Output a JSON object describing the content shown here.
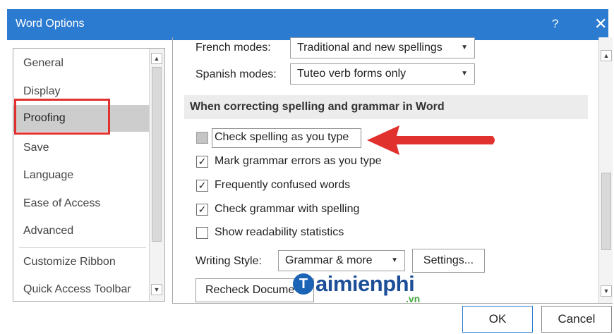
{
  "window": {
    "title": "Word Options",
    "help_glyph": "?",
    "close_glyph": "✕"
  },
  "sidebar": {
    "items": [
      {
        "label": "General"
      },
      {
        "label": "Display"
      },
      {
        "label": "Proofing",
        "selected": true
      },
      {
        "label": "Save"
      },
      {
        "label": "Language"
      },
      {
        "label": "Ease of Access"
      },
      {
        "label": "Advanced"
      },
      {
        "label": "Customize Ribbon"
      },
      {
        "label": "Quick Access Toolbar"
      }
    ]
  },
  "content": {
    "french_modes_label": "French modes:",
    "french_modes_value": "Traditional and new spellings",
    "spanish_modes_label": "Spanish modes:",
    "spanish_modes_value": "Tuteo verb forms only",
    "section_title": "When correcting spelling and grammar in Word",
    "options": [
      {
        "label": "Check spelling as you type",
        "checked": false
      },
      {
        "label": "Mark grammar errors as you type",
        "checked": true
      },
      {
        "label": "Frequently confused words",
        "checked": true
      },
      {
        "label": "Check grammar with spelling",
        "checked": true
      },
      {
        "label": "Show readability statistics",
        "checked": false
      }
    ],
    "writing_style_label": "Writing Style:",
    "writing_style_value": "Grammar & more",
    "settings_button": "Settings...",
    "recheck_button": "Recheck Docume"
  },
  "watermark": {
    "logo_letter": "T",
    "brand": "aimienphi",
    "tld": ".vn"
  },
  "footer": {
    "ok_button": "OK",
    "cancel_button": "Cancel"
  },
  "colors": {
    "titlebar": "#2b7bd1",
    "highlight": "#e0312f",
    "arrow": "#e0312f",
    "selected_item": "#cdcdcd"
  },
  "icons": {
    "dropdown_arrow": "▼",
    "scroll_up": "▲",
    "scroll_down": "▼",
    "check": "✓"
  }
}
